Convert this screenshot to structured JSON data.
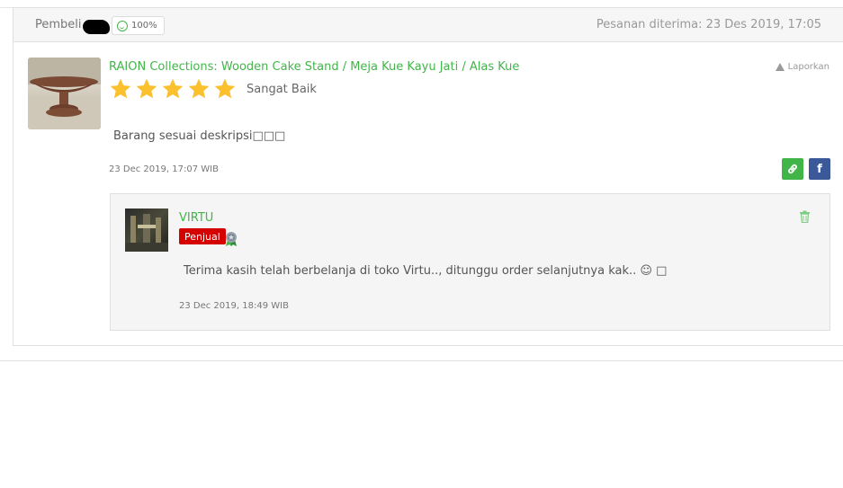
{
  "header": {
    "buyer_label": "Pembeli",
    "reputation": "100%",
    "order_received": "Pesanan diterima: 23 Des 2019, 17:05"
  },
  "review": {
    "product_title": "RAION Collections: Wooden Cake Stand / Meja Kue Kayu Jati / Alas Kue",
    "rating": 5,
    "rating_max": 5,
    "rating_text": "Sangat Baik",
    "report_label": "Laporkan",
    "text": "Barang sesuai deskripsi□□□",
    "time": "23 Dec 2019, 17:07 WIB"
  },
  "share": {
    "link_icon": "link-icon",
    "facebook_icon": "facebook-icon",
    "facebook_glyph": "f"
  },
  "reply": {
    "seller_name": "VIRTU",
    "seller_badge": "Penjual",
    "text": "Terima kasih telah berbelanja di toko Virtu.., ditunggu order selanjutnya kak.. ☺ □",
    "time": "23 Dec 2019, 18:49 WIB"
  },
  "colors": {
    "accent_green": "#42b549",
    "star_yellow": "#fbc02d",
    "seller_badge_red": "#d50000",
    "facebook_blue": "#3b5998"
  }
}
